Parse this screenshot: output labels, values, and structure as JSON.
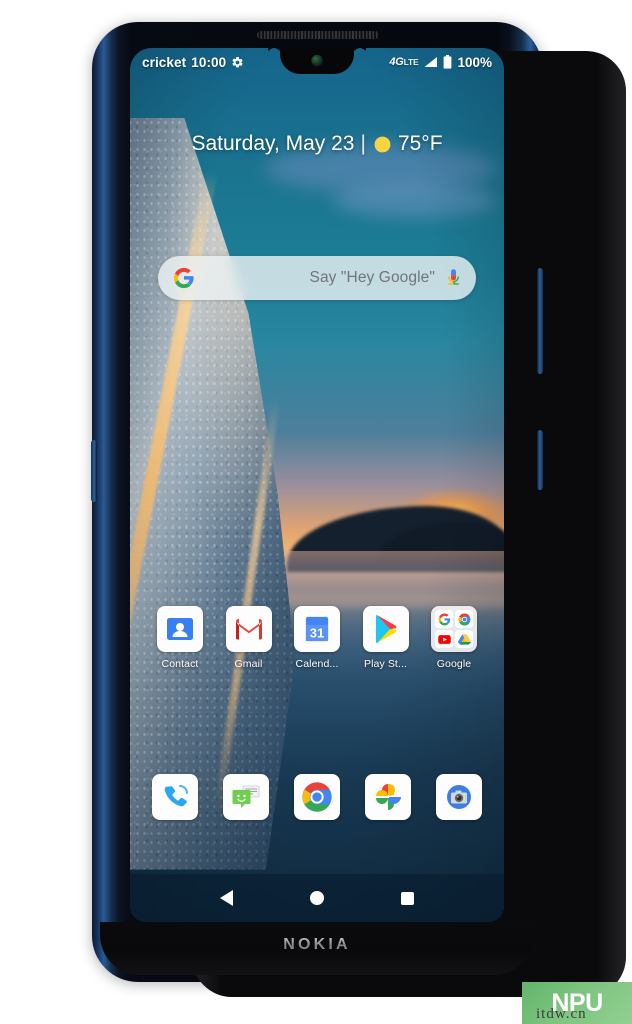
{
  "device": {
    "brand": "NOKIA",
    "screen_label": "home-screen"
  },
  "statusbar": {
    "carrier": "cricket",
    "time": "10:00",
    "settings_icon": "gear-icon",
    "network_type_primary": "4G",
    "network_type_secondary": "LTE",
    "signal_icon": "signal-bars-icon",
    "battery_icon": "battery-full-icon",
    "battery_percent": "100%"
  },
  "date_widget": {
    "date": "Saturday, May 23",
    "separator": "|",
    "weather_icon": "sun-icon",
    "temperature": "75°F"
  },
  "search": {
    "logo_icon": "google-g-icon",
    "placeholder": "Say \"Hey Google\"",
    "mic_icon": "microphone-icon"
  },
  "apps": [
    {
      "label": "Contact",
      "icon": "google-contacts-icon"
    },
    {
      "label": "Gmail",
      "icon": "gmail-icon"
    },
    {
      "label": "Calend...",
      "icon": "google-calendar-icon"
    },
    {
      "label": "Play St...",
      "icon": "google-play-store-icon"
    },
    {
      "label": "Google",
      "icon": "google-folder-icon",
      "folder": [
        {
          "icon": "google-g-icon"
        },
        {
          "icon": "chrome-icon"
        },
        {
          "icon": "youtube-icon"
        },
        {
          "icon": "google-drive-icon"
        }
      ]
    }
  ],
  "dock": [
    {
      "name": "Phone",
      "icon": "phone-icon"
    },
    {
      "name": "Messages",
      "icon": "messages-icon"
    },
    {
      "name": "Chrome",
      "icon": "chrome-icon"
    },
    {
      "name": "Photos",
      "icon": "google-photos-icon"
    },
    {
      "name": "Camera",
      "icon": "camera-icon"
    }
  ],
  "navbar": {
    "back_icon": "back-triangle-icon",
    "home_icon": "home-circle-icon",
    "recents_icon": "recents-square-icon"
  },
  "hardware": {
    "volume_button": "volume-rocker",
    "power_button": "power-button",
    "assistant_button": "assistant-key",
    "earpiece": "earpiece-speaker",
    "front_camera": "front-camera"
  },
  "watermark": {
    "logo_text": "NPU",
    "site_text": "itdw.cn"
  },
  "colors": {
    "accent_blue": "#1a73e8",
    "google_red": "#ea4335",
    "google_yellow": "#fbbc05",
    "google_green": "#34a853",
    "watermark_green": "#7cc47f",
    "phone_frame_blue": "#2b5d99"
  }
}
